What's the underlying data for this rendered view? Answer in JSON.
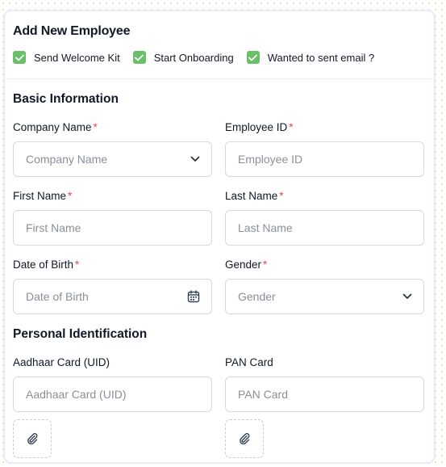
{
  "title": "Add New Employee",
  "checks": [
    {
      "label": "Send Welcome Kit",
      "checked": true
    },
    {
      "label": "Start Onboarding",
      "checked": true
    },
    {
      "label": "Wanted to sent email ?",
      "checked": true
    }
  ],
  "sections": {
    "basic": "Basic Information",
    "personal": "Personal Identification"
  },
  "fields": {
    "company": {
      "label": "Company Name",
      "placeholder": "Company Name",
      "required": "*"
    },
    "employee_id": {
      "label": "Employee ID",
      "placeholder": "Employee ID",
      "required": "*"
    },
    "first_name": {
      "label": "First Name",
      "placeholder": "First Name",
      "required": "*"
    },
    "last_name": {
      "label": "Last Name",
      "placeholder": "Last Name",
      "required": "*"
    },
    "dob": {
      "label": "Date of Birth",
      "placeholder": "Date of Birth",
      "required": "*"
    },
    "gender": {
      "label": "Gender",
      "placeholder": "Gender",
      "required": "*"
    },
    "aadhaar": {
      "label": "Aadhaar Card (UID)",
      "placeholder": "Aadhaar Card (UID)"
    },
    "pan": {
      "label": "PAN Card",
      "placeholder": "PAN Card"
    }
  },
  "icons": {
    "dropdown": "chevron-down-icon",
    "calendar": "calendar-icon",
    "attach": "paperclip-icon",
    "check": "checkmark-icon"
  },
  "colors": {
    "checkbox": "#6abf69",
    "required": "#e5484d",
    "border": "#d6d9e0"
  }
}
